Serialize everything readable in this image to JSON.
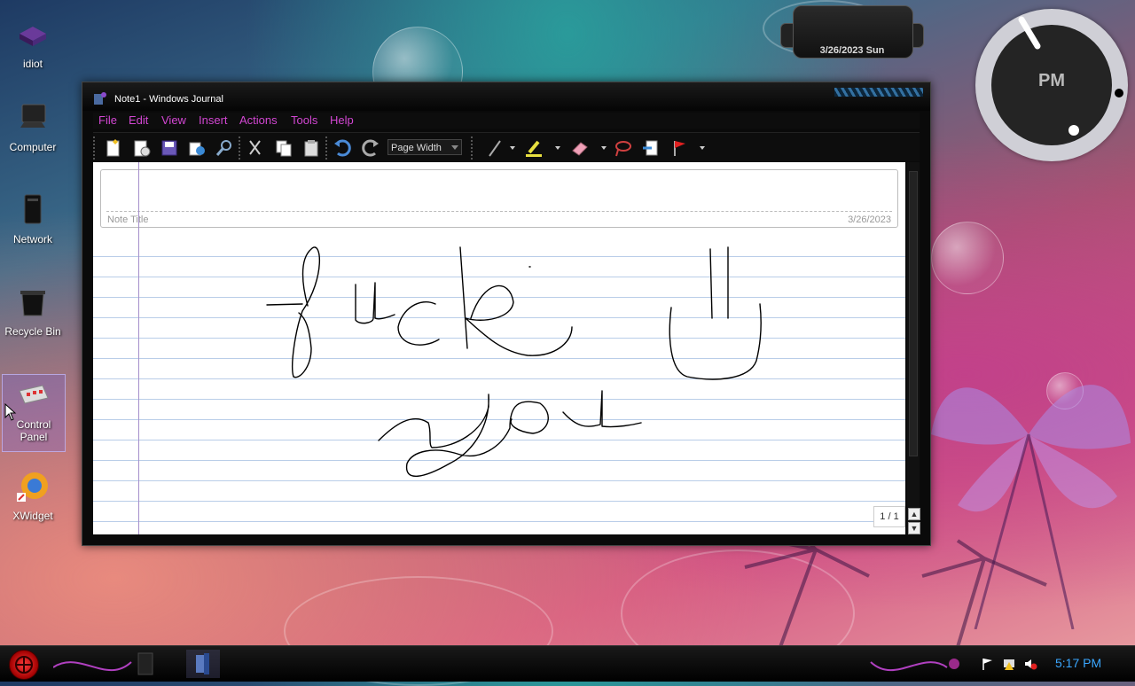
{
  "desktop": {
    "icons": [
      {
        "label": "idiot"
      },
      {
        "label": "Computer"
      },
      {
        "label": "Network"
      },
      {
        "label": "Recycle Bin"
      },
      {
        "label": "Control Panel"
      },
      {
        "label": "XWidget"
      }
    ]
  },
  "gadgets": {
    "date": "3/26/2023 Sun",
    "clock_period": "PM"
  },
  "window": {
    "title": "Note1 - Windows Journal",
    "menu": [
      "File",
      "Edit",
      "View",
      "Insert",
      "Actions",
      "Tools",
      "Help"
    ],
    "toolbar": {
      "zoom_value": "Page Width",
      "icons": [
        "new-note-icon",
        "open-note-icon",
        "save-icon",
        "send-icon",
        "find-icon",
        "cut-icon",
        "copy-icon",
        "paste-icon",
        "undo-icon",
        "redo-icon",
        "pen-icon",
        "highlighter-icon",
        "eraser-icon",
        "lasso-select-icon",
        "insert-space-icon",
        "flag-icon"
      ]
    },
    "note": {
      "title_label": "Note Title",
      "date": "3/26/2023",
      "page_counter": "1 / 1"
    }
  },
  "taskbar": {
    "time": "5:17 PM",
    "apps": [
      "journal-app"
    ]
  },
  "colors": {
    "menu_text": "#d246d2",
    "clock_text": "#3aa7ff",
    "rule_lines": "#b9cde8",
    "margin_line": "#a58fcb"
  }
}
